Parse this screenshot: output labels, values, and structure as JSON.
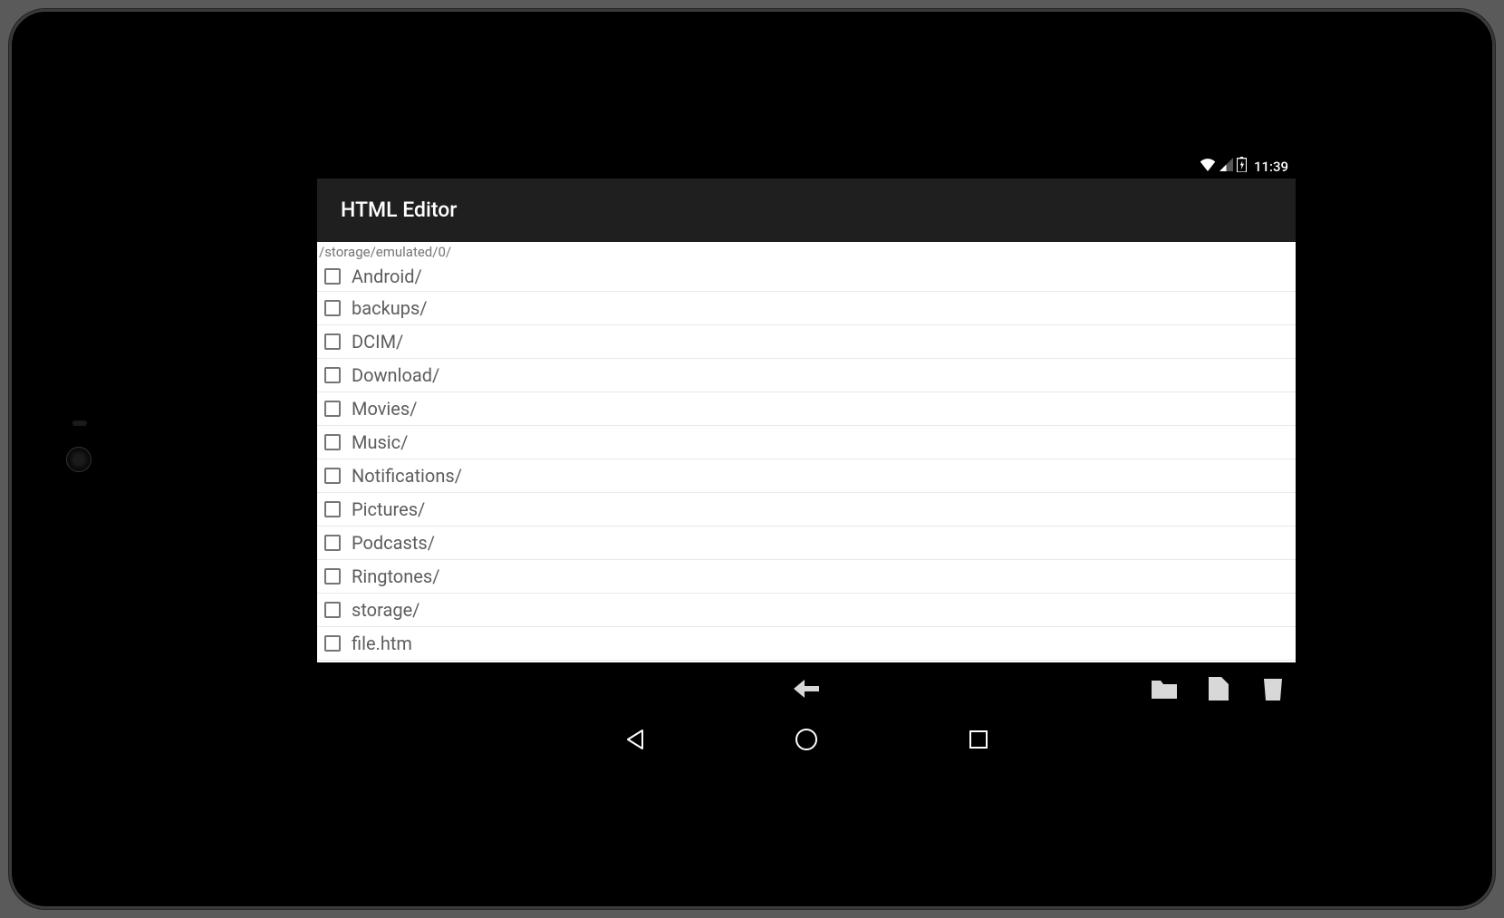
{
  "status": {
    "time": "11:39"
  },
  "app": {
    "title": "HTML Editor"
  },
  "path": "/storage/emulated/0/",
  "files": [
    {
      "name": "Android/"
    },
    {
      "name": "backups/"
    },
    {
      "name": "DCIM/"
    },
    {
      "name": "Download/"
    },
    {
      "name": "Movies/"
    },
    {
      "name": "Music/"
    },
    {
      "name": "Notifications/"
    },
    {
      "name": "Pictures/"
    },
    {
      "name": "Podcasts/"
    },
    {
      "name": "Ringtones/"
    },
    {
      "name": "storage/"
    },
    {
      "name": "file.htm"
    }
  ]
}
